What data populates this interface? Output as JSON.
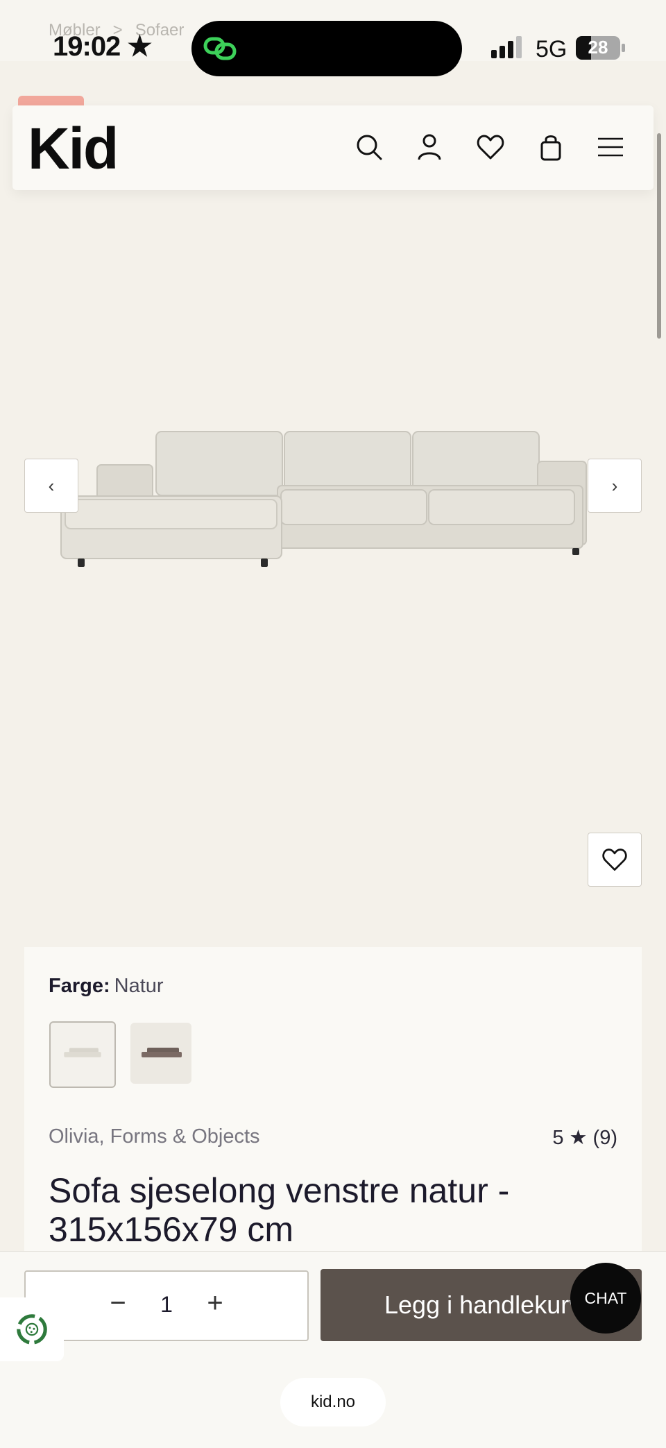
{
  "status_bar": {
    "time": "19:02",
    "network": "5G",
    "battery_level": "28"
  },
  "breadcrumb": {
    "items": [
      "Møbler",
      "Sofaer"
    ],
    "separator": ">"
  },
  "header": {
    "logo": "Kid",
    "icons": [
      "search-icon",
      "account-icon",
      "heart-icon",
      "shopping-bag-icon",
      "menu-icon"
    ]
  },
  "gallery": {
    "prev_label": "‹",
    "next_label": "›"
  },
  "product": {
    "color_label": "Farge:",
    "color_value": "Natur",
    "brand": "Olivia, Forms & Objects",
    "rating": "5 ★ (9)",
    "title": "Sofa sjeselong venstre natur - 315x156x79 cm",
    "swatch_colors": [
      "#e7e4dc",
      "#7b6a64"
    ]
  },
  "cart": {
    "qty_minus": "−",
    "quantity": "1",
    "qty_plus": "+",
    "add_label": "Legg i handlekurv",
    "chat_label": "CHAT"
  },
  "browser": {
    "url": "kid.no"
  },
  "colors": {
    "page_bg": "#f4f1ea",
    "add_button": "#5b524c",
    "eco_green": "#2e7a3c",
    "promo": "#f1a79b"
  }
}
